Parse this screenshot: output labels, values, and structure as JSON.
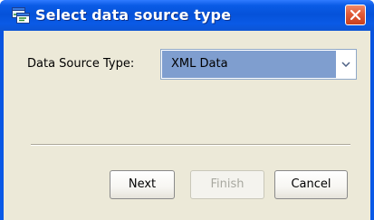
{
  "window": {
    "title": "Select data source type",
    "icon": "data-source-icon",
    "close_icon": "close-icon"
  },
  "form": {
    "data_source_type_label": "Data Source Type:",
    "data_source_type_value": "XML Data",
    "dropdown_icon": "chevron-down-icon"
  },
  "buttons": {
    "next_label": "Next",
    "finish_label": "Finish",
    "cancel_label": "Cancel"
  },
  "colors": {
    "titlebar": "#0a5ae6",
    "close_button": "#e05a37",
    "dialog_background": "#ece9d8",
    "selected_value_background": "#7f9ecf",
    "disabled_text": "#a8a8a0"
  }
}
